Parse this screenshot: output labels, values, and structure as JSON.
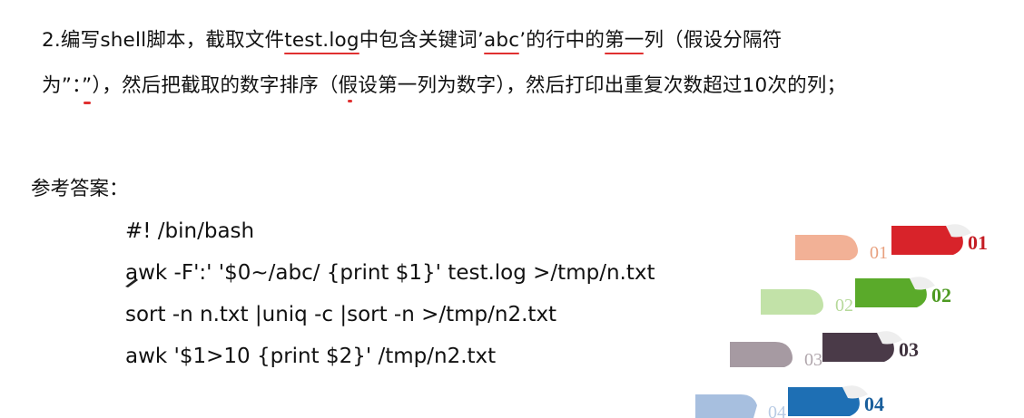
{
  "question": {
    "line1": {
      "p1": "2.编写shell脚本，截取文件",
      "file": "test.log",
      "p2": "中包含关键词’",
      "keyword": "abc",
      "p3": "’的行中的",
      "first": "第一",
      "p4": "列（假设分隔符"
    },
    "line2": "为”：”），然后把截取的数字排序（假设第一列为数字），然后打印出重复次数超过10次的列；"
  },
  "answer_label": "参考答案：",
  "code": [
    "#! /bin/bash",
    "awk -F':' '$0~/abc/ {print $1}' test.log >/tmp/n.txt",
    "sort -n n.txt |uniq -c |sort -n >/tmp/n2.txt",
    "awk '$1>10 {print $2}' /tmp/n2.txt"
  ],
  "decor": {
    "labels": [
      "01",
      "02",
      "03",
      "04"
    ],
    "colors": [
      "#d8232a",
      "#5aaa2a",
      "#4a3a48",
      "#1e6fb4"
    ],
    "faded_colors": [
      "#f2b196",
      "#c2e2a8",
      "#a69aa2",
      "#a7bfdf"
    ]
  }
}
